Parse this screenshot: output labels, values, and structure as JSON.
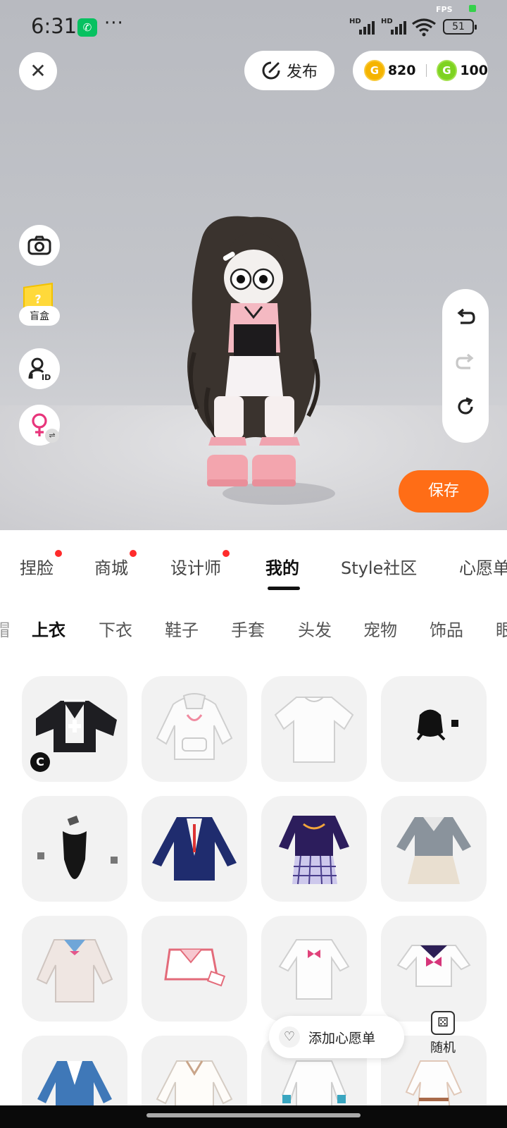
{
  "status_bar": {
    "time": "6:31",
    "wechat_icon": "wechat-icon",
    "overflow": "···",
    "fps": "FPS",
    "battery": "51"
  },
  "top_bar": {
    "publish_label": "发布",
    "gold_amount": "820",
    "green_amount": "100",
    "gold_coin_letter": "G",
    "green_coin_letter": "G"
  },
  "left_tools": {
    "blindbox_label": "盲盒",
    "blindbox_glyph": "?"
  },
  "save_label": "保存",
  "tabs": [
    {
      "label": "捏脸",
      "dot": true
    },
    {
      "label": "商城",
      "dot": true
    },
    {
      "label": "设计师",
      "dot": true
    },
    {
      "label": "我的",
      "dot": false,
      "active": true
    },
    {
      "label": "Style社区",
      "dot": false
    },
    {
      "label": "心愿单",
      "dot": false
    }
  ],
  "subtabs": [
    {
      "label": "上衣",
      "active": true
    },
    {
      "label": "下衣"
    },
    {
      "label": "鞋子"
    },
    {
      "label": "手套"
    },
    {
      "label": "头发"
    },
    {
      "label": "宠物"
    },
    {
      "label": "饰品"
    },
    {
      "label": "眼"
    }
  ],
  "items": [
    {
      "name": "black-white-maid-jacket",
      "creator_badge": "C"
    },
    {
      "name": "white-hoodie-dress"
    },
    {
      "name": "white-tshirt"
    },
    {
      "name": "black-small-accessory-top"
    },
    {
      "name": "black-bodysuit-with-accessories"
    },
    {
      "name": "navy-school-blazer"
    },
    {
      "name": "purple-top-with-plaid-skirt"
    },
    {
      "name": "grey-sailor-uniform"
    },
    {
      "name": "cream-cardigan-sailor"
    },
    {
      "name": "pink-crop-top"
    },
    {
      "name": "white-shirt-pink-bow"
    },
    {
      "name": "white-sailor-top-pink-bow"
    },
    {
      "name": "blue-blazer"
    },
    {
      "name": "white-blouse"
    },
    {
      "name": "white-jacket-teal-cuffs"
    },
    {
      "name": "white-dress-belt"
    }
  ],
  "wishlist_label": "添加心愿单",
  "random_label": "随机",
  "colors": {
    "accent_orange": "#ff6d16",
    "red_dot": "#ff2b2b",
    "gold_coin": "#f5b400",
    "green_coin": "#7ed321"
  }
}
